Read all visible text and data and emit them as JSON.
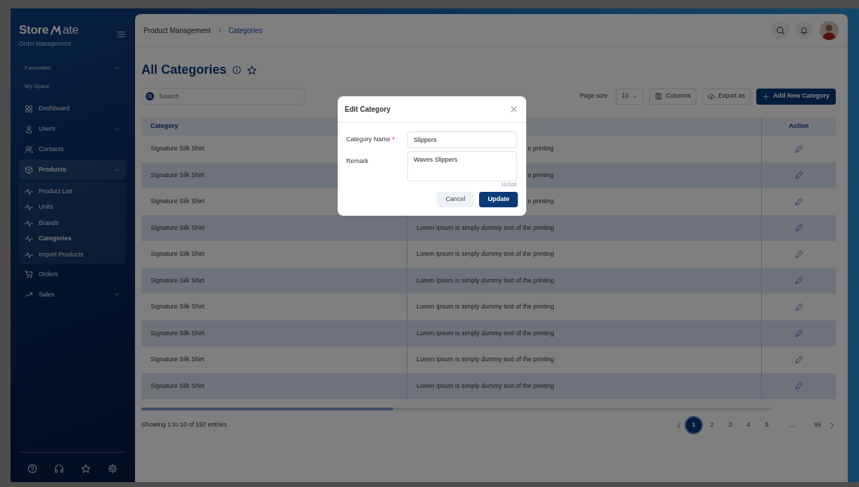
{
  "logo": {
    "prefix": "Store",
    "suffix": "ate",
    "subtitle": "Order Management"
  },
  "sidebar": {
    "favourites": {
      "label": "Favourites",
      "expanded": false
    },
    "section_label": "My Space",
    "items": [
      {
        "label": "Dashboard",
        "selected": false
      },
      {
        "label": "Users",
        "selected": false,
        "expanded": false
      },
      {
        "label": "Contacts",
        "selected": false
      },
      {
        "label": "Products",
        "selected": true,
        "expanded": true,
        "children": [
          {
            "label": "Product List",
            "selected": false
          },
          {
            "label": "Units",
            "selected": false
          },
          {
            "label": "Brands",
            "selected": false
          },
          {
            "label": "Categories",
            "selected": true
          },
          {
            "label": "Import Products",
            "selected": false
          }
        ]
      },
      {
        "label": "Orders",
        "selected": false
      },
      {
        "label": "Sales",
        "selected": false,
        "expanded": false
      }
    ]
  },
  "breadcrumb": [
    "Product Management",
    "Categories"
  ],
  "page_title": "All Categories",
  "search": {
    "placeholder": "Search"
  },
  "page_size": {
    "label": "Page size",
    "value": "10"
  },
  "toolbar_buttons": [
    "Columns",
    "Export as"
  ],
  "primary_button": "Add New Category",
  "table": {
    "columns": {
      "category": "Category",
      "action": "Action"
    },
    "rows": [
      {
        "category": "Signature Silk Shirt",
        "remark": "e printing",
        "covered": true
      },
      {
        "category": "Signature Silk Shirt",
        "remark": "e printing",
        "covered": true
      },
      {
        "category": "Signature Silk Shirt",
        "remark": "e printing",
        "covered": true
      },
      {
        "category": "Signature Silk Shirt",
        "remark": "Lorem Ipsum is simply dummy text of the printing",
        "covered": false
      },
      {
        "category": "Signature Silk Shirt",
        "remark": "Lorem Ipsum is simply dummy text of the printing",
        "covered": false
      },
      {
        "category": "Signature Silk Shirt",
        "remark": "Lorem Ipsum is simply dummy text of the printing",
        "covered": false
      },
      {
        "category": "Signature Silk Shirt",
        "remark": "Lorem Ipsum is simply dummy text of the printing",
        "covered": false
      },
      {
        "category": "Signature Silk Shirt",
        "remark": "Lorem Ipsum is simply dummy text of the printing",
        "covered": false
      },
      {
        "category": "Signature Silk Shirt",
        "remark": "Lorem Ipsum is simply dummy text of the printing",
        "covered": false
      },
      {
        "category": "Signature Silk Shirt",
        "remark": "Lorem Ipsum is simply dummy text of the printing",
        "covered": false
      }
    ]
  },
  "pagination": {
    "info": "Showing 1 to 10 of 150 entries",
    "pages": [
      {
        "label": "1",
        "selected": true
      },
      {
        "label": "2",
        "selected": false
      },
      {
        "label": "3",
        "selected": false
      },
      {
        "label": "4",
        "selected": false
      },
      {
        "label": "5",
        "selected": false
      },
      {
        "label": "...",
        "selected": false
      },
      {
        "label": "99",
        "selected": false
      }
    ]
  },
  "modal": {
    "title": "Edit Category",
    "fields": [
      {
        "kind": "input",
        "label": "Category Name",
        "required_mark": "*",
        "value": "Slippers"
      },
      {
        "kind": "textarea",
        "label": "Remark",
        "value": "Waves Slippers",
        "counter": "10/100"
      }
    ],
    "cancel": "Cancel",
    "submit": "Update"
  }
}
